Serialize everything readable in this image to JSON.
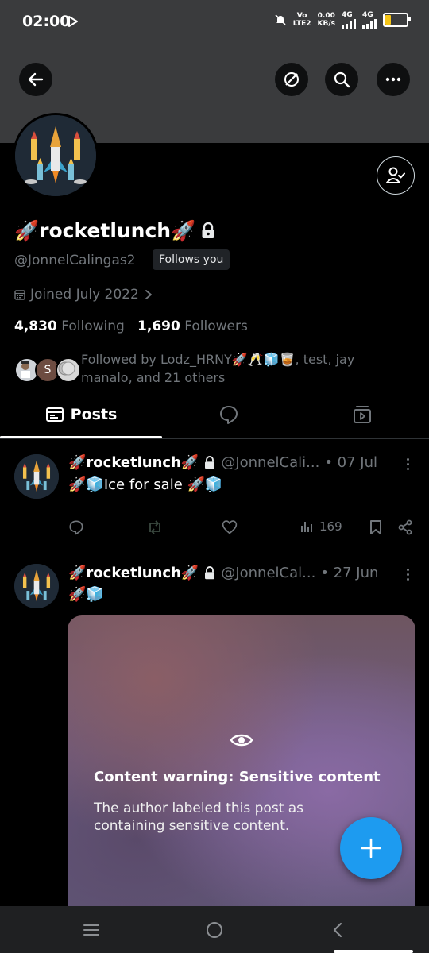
{
  "status_bar": {
    "time": "02:00",
    "network_label_top": "Vo",
    "network_label_bottom": "LTE2",
    "speed_value": "0.00",
    "speed_unit": "KB/s",
    "sim1": "4G",
    "sim2": "4G",
    "battery_level": 0.3
  },
  "profile": {
    "display_name": "🚀rocketlunch🚀",
    "handle": "@JonnelCalingas2",
    "follows_you": "Follows you",
    "joined": "Joined July 2022",
    "following_count": "4,830",
    "following_label": "Following",
    "followers_count": "1,690",
    "followers_label": "Followers",
    "followed_by": "Followed by Lodz_HRNY🚀🥂🧊🥃, test, jay manalo, and 21 others",
    "mini_avatar_letter": "S"
  },
  "tabs": [
    {
      "label": "Posts",
      "icon": "posts-icon",
      "active": true
    },
    {
      "label": "",
      "icon": "replies-icon",
      "active": false
    },
    {
      "label": "",
      "icon": "media-icon",
      "active": false
    }
  ],
  "posts": [
    {
      "name": "🚀rocketlunch🚀",
      "handle": "@JonnelCali...",
      "date": "• 07 Jul",
      "text": "🚀🧊Ice for sale 🚀🧊",
      "views": "169"
    },
    {
      "name": "🚀rocketlunch🚀",
      "handle": "@JonnelCal...",
      "date": "• 27 Jun",
      "text": "🚀🧊",
      "warning_title": "Content warning: Sensitive content",
      "warning_text": "The author labeled this post as containing sensitive content."
    }
  ],
  "colors": {
    "accent": "#1d9bf0",
    "background": "#000000",
    "banner": "#3a3b3d",
    "muted_text": "#71767b"
  }
}
